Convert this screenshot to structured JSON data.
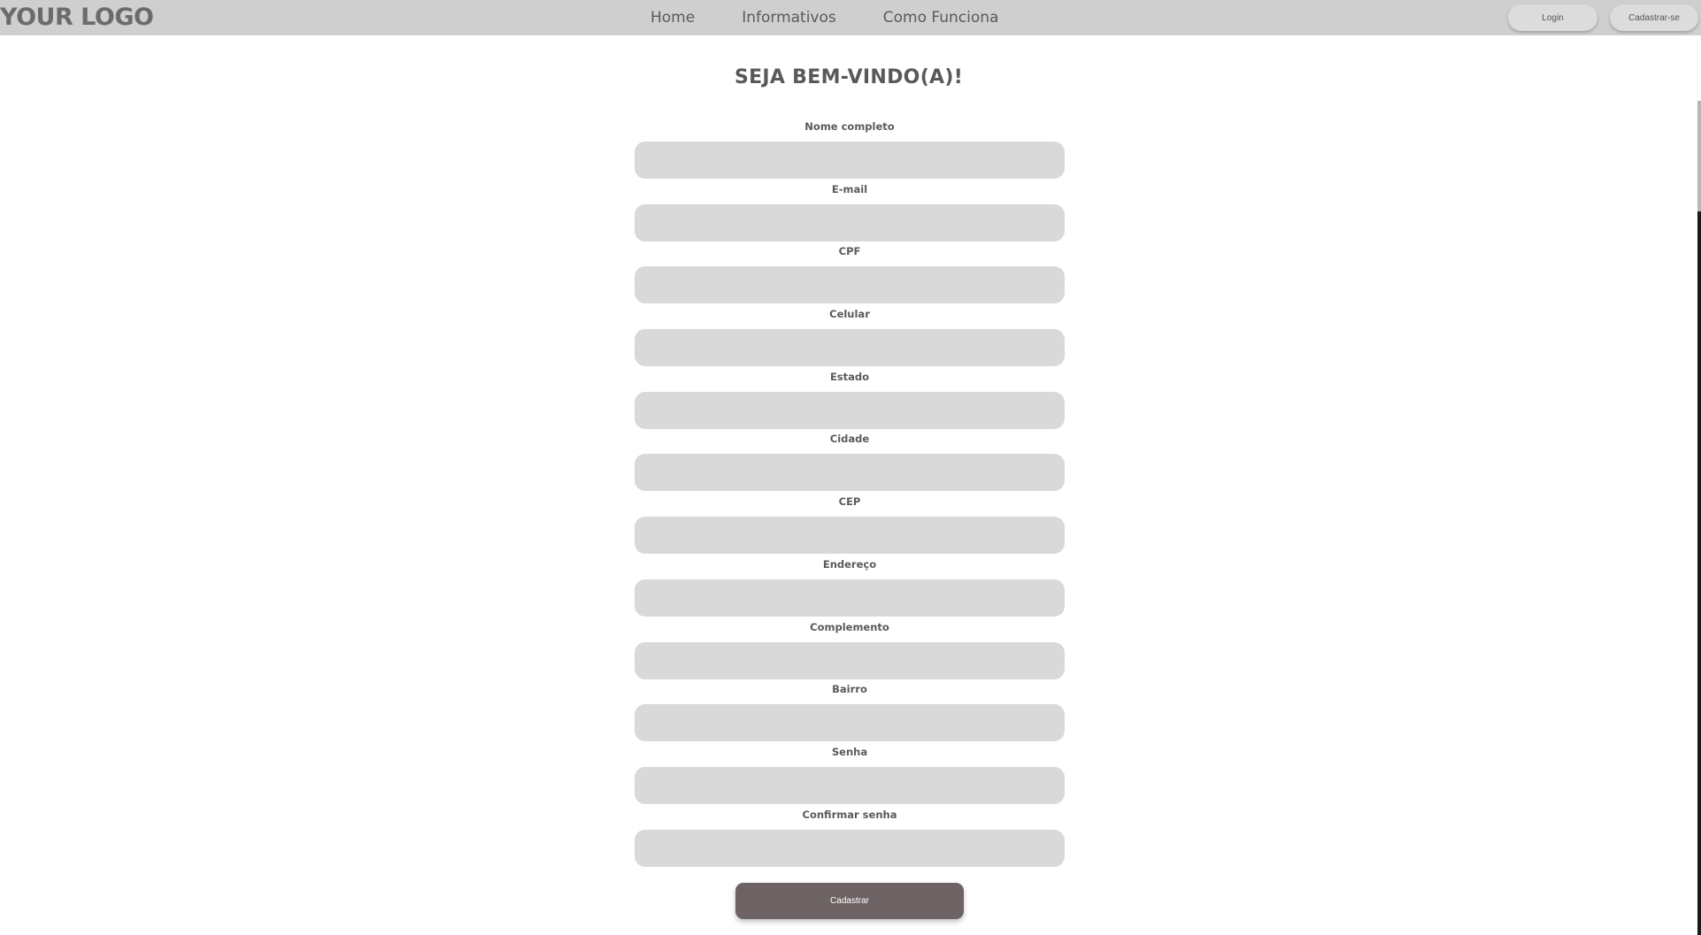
{
  "header": {
    "logo": "YOUR LOGO",
    "nav": {
      "home": "Home",
      "informativos": "Informativos",
      "como_funciona": "Como Funciona"
    },
    "login_label": "Login",
    "signup_label": "Cadastrar-se"
  },
  "page_title": "SEJA BEM-VINDO(A)!",
  "form": {
    "fields": [
      {
        "label": "Nome completo",
        "value": ""
      },
      {
        "label": "E-mail",
        "value": ""
      },
      {
        "label": "CPF",
        "value": ""
      },
      {
        "label": "Celular",
        "value": ""
      },
      {
        "label": "Estado",
        "value": ""
      },
      {
        "label": "Cidade",
        "value": ""
      },
      {
        "label": "CEP",
        "value": ""
      },
      {
        "label": "Endereço",
        "value": ""
      },
      {
        "label": "Complemento",
        "value": ""
      },
      {
        "label": "Bairro",
        "value": ""
      },
      {
        "label": "Senha",
        "value": ""
      },
      {
        "label": "Confirmar senha",
        "value": ""
      }
    ],
    "submit_label": "Cadastrar"
  },
  "colors": {
    "navbar_bg": "#cfcfcf",
    "input_bg": "#d9d9d9",
    "submit_bg": "#6e6364",
    "text": "#595959"
  }
}
